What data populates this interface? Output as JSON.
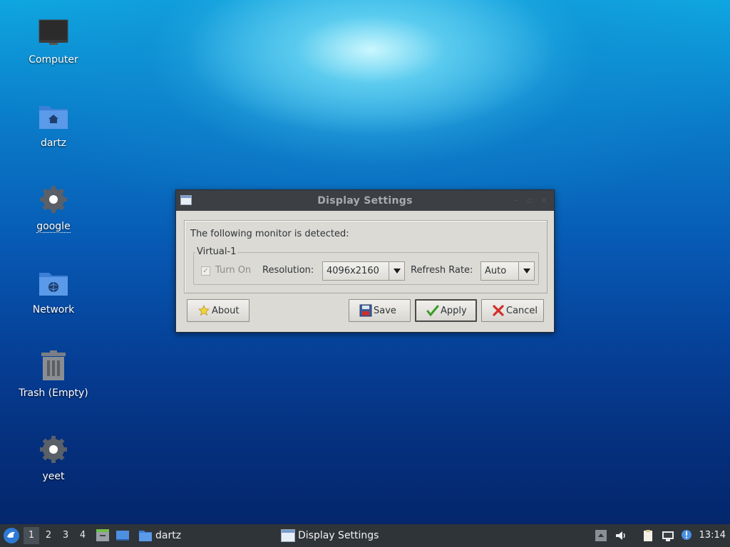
{
  "desktop": {
    "icons": [
      {
        "label": "Computer",
        "icon": "monitor-icon"
      },
      {
        "label": "dartz",
        "icon": "home-folder-icon"
      },
      {
        "label": "google",
        "icon": "gear-icon"
      },
      {
        "label": "Network",
        "icon": "network-folder-icon"
      },
      {
        "label": "Trash (Empty)",
        "icon": "trash-icon"
      },
      {
        "label": "yeet",
        "icon": "gear-icon"
      }
    ]
  },
  "dialog": {
    "title": "Display Settings",
    "detected_text": "The following monitor is detected:",
    "monitor_name": "Virtual-1",
    "turn_on_label": "Turn On",
    "turn_on_checked": true,
    "resolution_label": "Resolution:",
    "resolution_value": "4096x2160",
    "refresh_label": "Refresh Rate:",
    "refresh_value": "Auto",
    "buttons": {
      "about": "About",
      "save": "Save",
      "apply": "Apply",
      "cancel": "Cancel"
    }
  },
  "taskbar": {
    "workspaces": [
      "1",
      "2",
      "3",
      "4"
    ],
    "active_workspace": "1",
    "tasks": [
      {
        "label": "dartz",
        "icon": "folder-icon"
      },
      {
        "label": "Display Settings",
        "icon": "window-icon"
      }
    ],
    "clock": "13:14"
  },
  "colors": {
    "taskbar_bg": "#2f3439",
    "titlebar_bg": "#3c3f44",
    "dialog_bg": "#dcdad5"
  }
}
